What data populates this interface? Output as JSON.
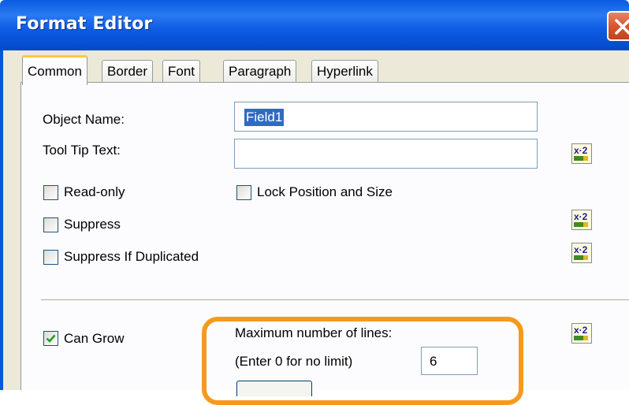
{
  "window": {
    "title": "Format Editor"
  },
  "tabs": [
    {
      "label": "Common",
      "active": true
    },
    {
      "label": "Border",
      "active": false
    },
    {
      "label": "Font",
      "active": false
    },
    {
      "label": "Paragraph",
      "active": false
    },
    {
      "label": "Hyperlink",
      "active": false
    }
  ],
  "common": {
    "object_name_label": "Object Name:",
    "object_name_value": "Field1",
    "tooltip_label": "Tool Tip Text:",
    "tooltip_value": "",
    "read_only_label": "Read-only",
    "read_only_checked": false,
    "lock_label": "Lock Position and Size",
    "lock_checked": false,
    "suppress_label": "Suppress",
    "suppress_checked": false,
    "suppress_dup_label": "Suppress If Duplicated",
    "suppress_dup_checked": false,
    "can_grow_label": "Can Grow",
    "can_grow_checked": true,
    "max_lines_label": "Maximum number of lines:",
    "max_lines_hint": "(Enter 0 for no limit)",
    "max_lines_value": "6"
  },
  "icons": {
    "close": "close-icon",
    "formula": "formula-icon",
    "check": "checkmark-icon"
  },
  "colors": {
    "titlebar": "#0a5be0",
    "dialog_bg": "#ece9d8",
    "selection": "#316ac5",
    "highlight": "#f59a1e",
    "check": "#21a121"
  }
}
